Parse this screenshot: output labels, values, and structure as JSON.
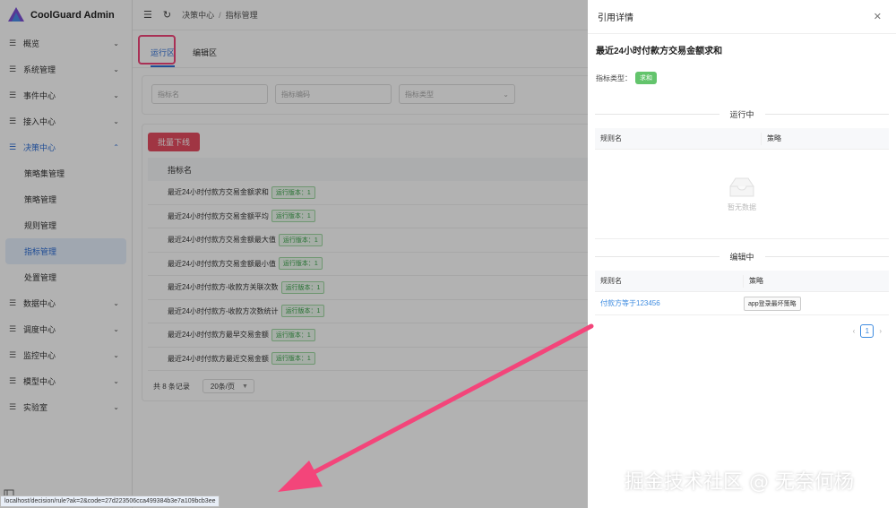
{
  "app": {
    "title": "CoolGuard Admin"
  },
  "sidebar": {
    "items": [
      {
        "label": "概览",
        "icon": "menu-lines-icon"
      },
      {
        "label": "系统管理",
        "icon": "menu-lines-icon"
      },
      {
        "label": "事件中心",
        "icon": "menu-lines-icon"
      },
      {
        "label": "接入中心",
        "icon": "menu-lines-icon"
      },
      {
        "label": "决策中心",
        "icon": "menu-lines-icon",
        "open": true
      },
      {
        "label": "数据中心",
        "icon": "menu-lines-icon"
      },
      {
        "label": "调度中心",
        "icon": "menu-lines-icon"
      },
      {
        "label": "监控中心",
        "icon": "menu-lines-icon"
      },
      {
        "label": "模型中心",
        "icon": "menu-lines-icon"
      },
      {
        "label": "实验室",
        "icon": "menu-lines-icon"
      }
    ],
    "submenu": [
      {
        "label": "策略集管理"
      },
      {
        "label": "策略管理"
      },
      {
        "label": "规则管理"
      },
      {
        "label": "指标管理",
        "active": true
      },
      {
        "label": "处置管理"
      }
    ]
  },
  "topbar": {
    "breadcrumb": [
      "决策中心",
      "指标管理"
    ]
  },
  "tabs": [
    {
      "label": "运行区",
      "active": true
    },
    {
      "label": "编辑区"
    }
  ],
  "filters": {
    "name_placeholder": "指标名",
    "code_placeholder": "指标编码",
    "type_placeholder": "指标类型"
  },
  "table": {
    "batch_button": "批量下线",
    "header": "指标名",
    "rows": [
      {
        "name": "最近24小时付款方交易金额求和",
        "tag": "运行版本：1"
      },
      {
        "name": "最近24小时付款方交易金额平均",
        "tag": "运行版本：1"
      },
      {
        "name": "最近24小时付款方交易金额最大值",
        "tag": "运行版本：1"
      },
      {
        "name": "最近24小时付款方交易金额最小值",
        "tag": "运行版本：1"
      },
      {
        "name": "最近24小时付款方-收款方关联次数",
        "tag": "运行版本：1"
      },
      {
        "name": "最近24小时付款方-收款方次数统计",
        "tag": "运行版本：1"
      },
      {
        "name": "最近24小时付款方最早交易金额",
        "tag": "运行版本：1"
      },
      {
        "name": "最近24小时付款方最近交易金额",
        "tag": "运行版本：1"
      }
    ],
    "total": "共 8 条记录",
    "page_size": "20条/页"
  },
  "drawer": {
    "title": "引用详情",
    "metric_name": "最近24小时付款方交易金额求和",
    "type_label": "指标类型：",
    "type_value": "求和",
    "running_section": "运行中",
    "editing_section": "编辑中",
    "col_rule": "规则名",
    "col_strategy": "策略",
    "empty_text": "暂无数据",
    "edit_rows": [
      {
        "rule": "付款方等于123456",
        "strategy": "app登录最坏策略"
      }
    ],
    "page": "1"
  },
  "status_url": "localhost/decision/rule?ak=2&code=27d223506cca499384b3e7a109bcb3ee",
  "watermark": "掘金技术社区 @ 无奈何杨",
  "colors": {
    "accent": "#2f6fd6",
    "danger": "#e54d61",
    "success": "#63c46c",
    "arrow": "#f3457a"
  }
}
